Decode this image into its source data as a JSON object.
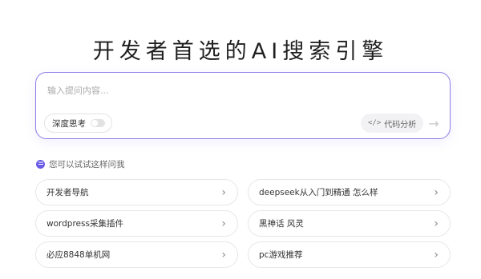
{
  "hero": {
    "title": "开发者首选的AI搜索引擎"
  },
  "search": {
    "placeholder": "输入提问内容...",
    "deep_think_label": "深度思考",
    "code_analysis_label": "代码分析",
    "code_icon": "code-icon",
    "send_icon": "arrow-right-icon",
    "accent_color": "#8f7ae8"
  },
  "suggestions": {
    "header": "您可以试试这样问我",
    "items": [
      {
        "label": "开发者导航"
      },
      {
        "label": "deepseek从入门到精通 怎么样"
      },
      {
        "label": "wordpress采集插件"
      },
      {
        "label": "黑神话 风灵"
      },
      {
        "label": "必应8848单机网"
      },
      {
        "label": "pc游戏推荐"
      }
    ]
  }
}
